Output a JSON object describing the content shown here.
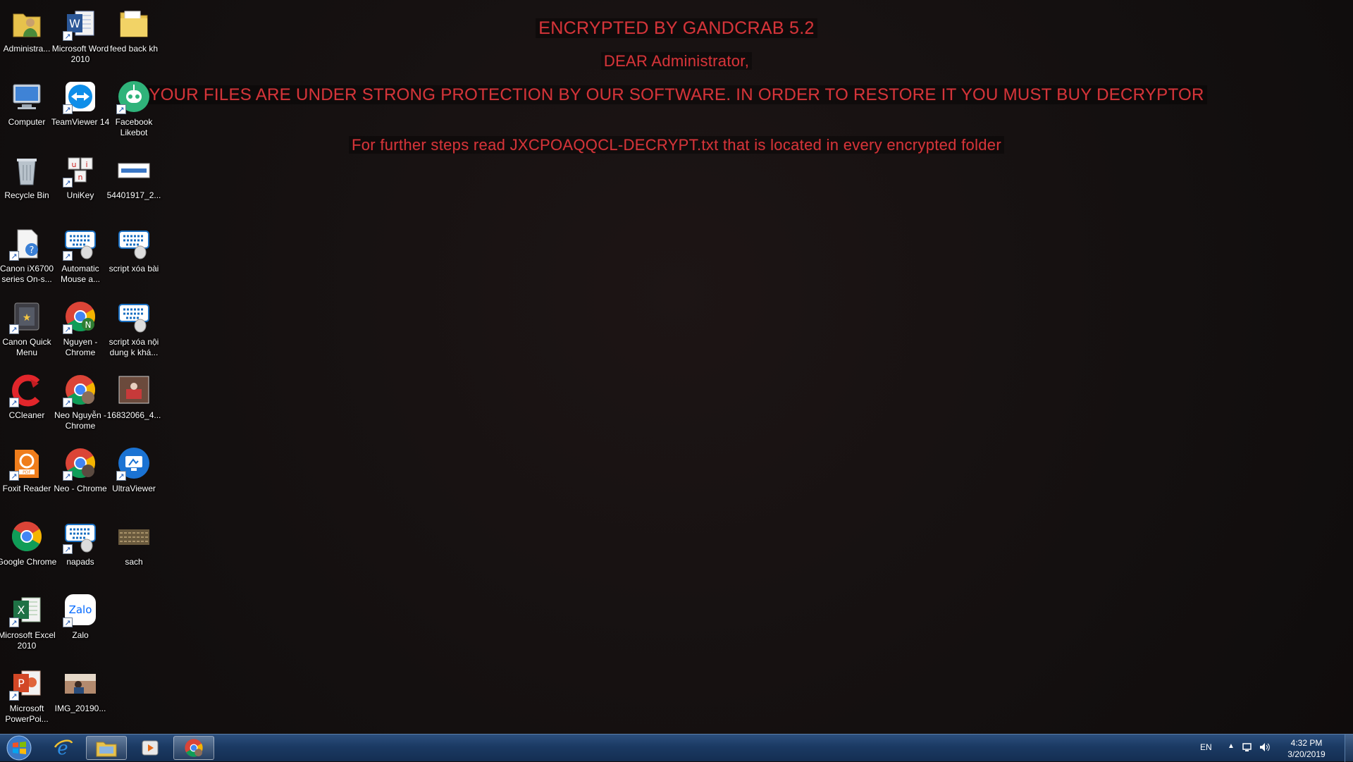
{
  "note": {
    "title": "ENCRYPTED BY GANDCRAB 5.2",
    "greeting": "DEAR Administrator,",
    "message": "YOUR FILES ARE UNDER STRONG PROTECTION BY OUR SOFTWARE. IN ORDER TO RESTORE IT YOU MUST BUY DECRYPTOR",
    "steps": "For further steps read JXCPOAQQCL-DECRYPT.txt that is located in every encrypted folder"
  },
  "desktop_icons": [
    {
      "label": "Administra...",
      "icon": "user-folder-icon"
    },
    {
      "label": "Microsoft Word 2010",
      "icon": "word-icon"
    },
    {
      "label": "feed back kh",
      "icon": "folder-icon"
    },
    {
      "label": "Computer",
      "icon": "computer-icon"
    },
    {
      "label": "TeamViewer 14",
      "icon": "teamviewer-icon"
    },
    {
      "label": "Facebook Likebot",
      "icon": "bot-icon"
    },
    {
      "label": "Recycle Bin",
      "icon": "recycle-bin-icon"
    },
    {
      "label": "UniKey",
      "icon": "unikey-icon"
    },
    {
      "label": "54401917_2...",
      "icon": "image-file-icon"
    },
    {
      "label": "Canon iX6700 series On-s...",
      "icon": "help-document-icon"
    },
    {
      "label": "Automatic Mouse a...",
      "icon": "keyboard-mouse-icon"
    },
    {
      "label": "script xóa bài",
      "icon": "keyboard-mouse-icon"
    },
    {
      "label": "Canon Quick Menu",
      "icon": "canon-menu-icon"
    },
    {
      "label": "Nguyen - Chrome",
      "icon": "chrome-icon"
    },
    {
      "label": "script xóa nội dung k khá...",
      "icon": "keyboard-mouse-icon"
    },
    {
      "label": "CCleaner",
      "icon": "ccleaner-icon"
    },
    {
      "label": "Neo Nguyễn - Chrome",
      "icon": "chrome-icon"
    },
    {
      "label": "16832066_4...",
      "icon": "photo-icon"
    },
    {
      "label": "Foxit Reader",
      "icon": "foxit-icon"
    },
    {
      "label": "Neo - Chrome",
      "icon": "chrome-icon"
    },
    {
      "label": "UltraViewer",
      "icon": "ultraviewer-icon"
    },
    {
      "label": "Google Chrome",
      "icon": "chrome-icon"
    },
    {
      "label": "napads",
      "icon": "keyboard-mouse-icon"
    },
    {
      "label": "sach",
      "icon": "photo-icon"
    },
    {
      "label": "Microsoft Excel 2010",
      "icon": "excel-icon"
    },
    {
      "label": "Zalo",
      "icon": "zalo-icon"
    },
    {
      "label": "Microsoft PowerPoi...",
      "icon": "powerpoint-icon"
    },
    {
      "label": "IMG_20190...",
      "icon": "photo-icon"
    }
  ],
  "taskbar": {
    "pinned": [
      "internet-explorer-icon",
      "file-explorer-icon",
      "media-player-icon",
      "chrome-icon"
    ],
    "language": "EN",
    "time": "4:32 PM",
    "date": "3/20/2019"
  },
  "colors": {
    "note_text": "#d2353a",
    "desktop_background": "#141010",
    "taskbar": "#1b3a63"
  }
}
